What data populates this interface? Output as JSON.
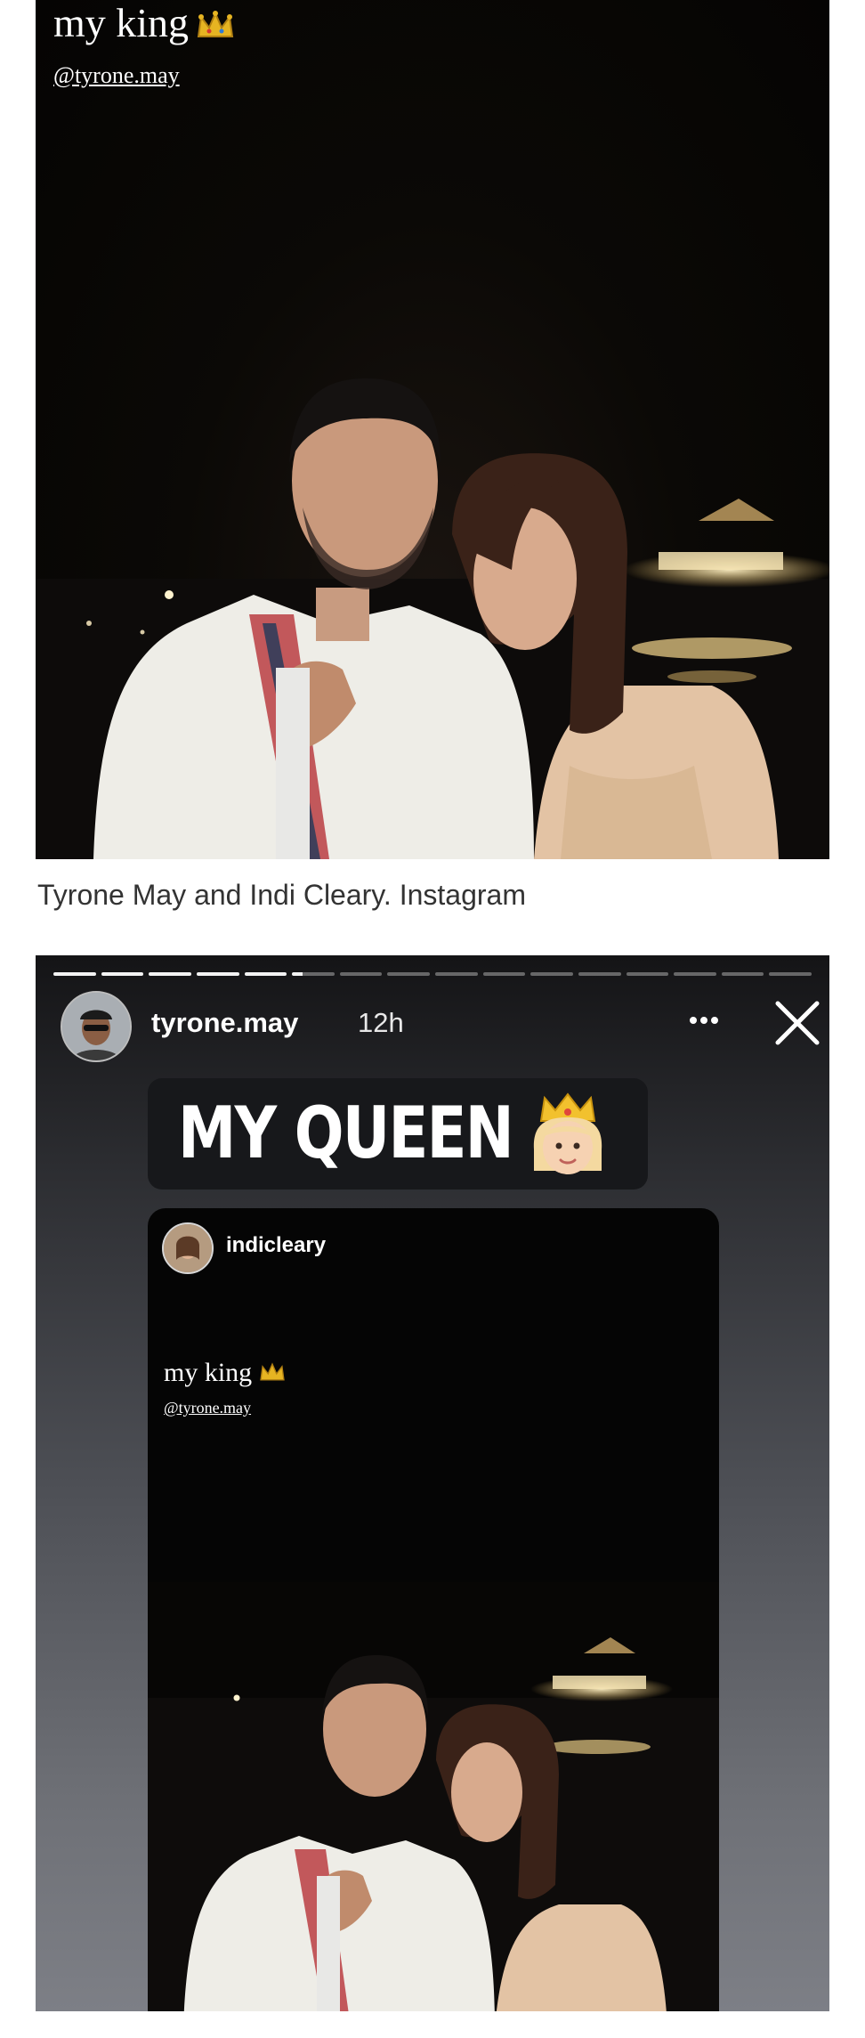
{
  "post": {
    "title": "my king",
    "handle": "@tyrone.may",
    "caption": "Tyrone May and Indi Cleary. Instagram"
  },
  "story": {
    "username": "tyrone.may",
    "timestamp": "12h",
    "sticker_text": "MY QUEEN",
    "progress_segments_total": 16,
    "progress_segments_viewed": 5,
    "icons": [
      "more-icon",
      "close-icon",
      "crown-icon",
      "princess-emoji-icon"
    ],
    "repost": {
      "username": "indicleary",
      "title": "my king",
      "handle": "@tyrone.may"
    }
  },
  "colors": {
    "story_bg_top": "#141416",
    "story_bg_bottom": "#7d7f86",
    "caption_text": "#333333",
    "crown": "#e6b422"
  }
}
